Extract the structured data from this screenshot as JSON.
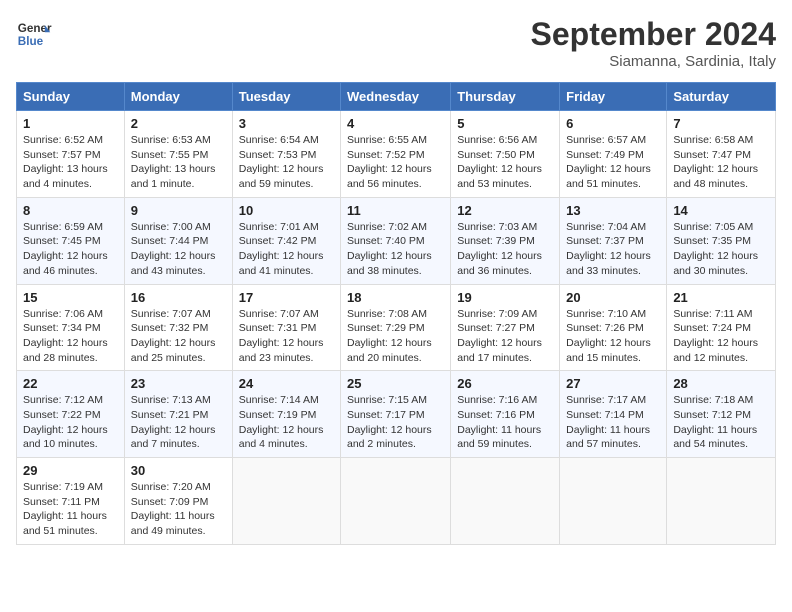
{
  "header": {
    "logo_line1": "General",
    "logo_line2": "Blue",
    "month_title": "September 2024",
    "location": "Siamanna, Sardinia, Italy"
  },
  "days_of_week": [
    "Sunday",
    "Monday",
    "Tuesday",
    "Wednesday",
    "Thursday",
    "Friday",
    "Saturday"
  ],
  "weeks": [
    [
      {
        "num": "1",
        "info": "Sunrise: 6:52 AM\nSunset: 7:57 PM\nDaylight: 13 hours\nand 4 minutes."
      },
      {
        "num": "2",
        "info": "Sunrise: 6:53 AM\nSunset: 7:55 PM\nDaylight: 13 hours\nand 1 minute."
      },
      {
        "num": "3",
        "info": "Sunrise: 6:54 AM\nSunset: 7:53 PM\nDaylight: 12 hours\nand 59 minutes."
      },
      {
        "num": "4",
        "info": "Sunrise: 6:55 AM\nSunset: 7:52 PM\nDaylight: 12 hours\nand 56 minutes."
      },
      {
        "num": "5",
        "info": "Sunrise: 6:56 AM\nSunset: 7:50 PM\nDaylight: 12 hours\nand 53 minutes."
      },
      {
        "num": "6",
        "info": "Sunrise: 6:57 AM\nSunset: 7:49 PM\nDaylight: 12 hours\nand 51 minutes."
      },
      {
        "num": "7",
        "info": "Sunrise: 6:58 AM\nSunset: 7:47 PM\nDaylight: 12 hours\nand 48 minutes."
      }
    ],
    [
      {
        "num": "8",
        "info": "Sunrise: 6:59 AM\nSunset: 7:45 PM\nDaylight: 12 hours\nand 46 minutes."
      },
      {
        "num": "9",
        "info": "Sunrise: 7:00 AM\nSunset: 7:44 PM\nDaylight: 12 hours\nand 43 minutes."
      },
      {
        "num": "10",
        "info": "Sunrise: 7:01 AM\nSunset: 7:42 PM\nDaylight: 12 hours\nand 41 minutes."
      },
      {
        "num": "11",
        "info": "Sunrise: 7:02 AM\nSunset: 7:40 PM\nDaylight: 12 hours\nand 38 minutes."
      },
      {
        "num": "12",
        "info": "Sunrise: 7:03 AM\nSunset: 7:39 PM\nDaylight: 12 hours\nand 36 minutes."
      },
      {
        "num": "13",
        "info": "Sunrise: 7:04 AM\nSunset: 7:37 PM\nDaylight: 12 hours\nand 33 minutes."
      },
      {
        "num": "14",
        "info": "Sunrise: 7:05 AM\nSunset: 7:35 PM\nDaylight: 12 hours\nand 30 minutes."
      }
    ],
    [
      {
        "num": "15",
        "info": "Sunrise: 7:06 AM\nSunset: 7:34 PM\nDaylight: 12 hours\nand 28 minutes."
      },
      {
        "num": "16",
        "info": "Sunrise: 7:07 AM\nSunset: 7:32 PM\nDaylight: 12 hours\nand 25 minutes."
      },
      {
        "num": "17",
        "info": "Sunrise: 7:07 AM\nSunset: 7:31 PM\nDaylight: 12 hours\nand 23 minutes."
      },
      {
        "num": "18",
        "info": "Sunrise: 7:08 AM\nSunset: 7:29 PM\nDaylight: 12 hours\nand 20 minutes."
      },
      {
        "num": "19",
        "info": "Sunrise: 7:09 AM\nSunset: 7:27 PM\nDaylight: 12 hours\nand 17 minutes."
      },
      {
        "num": "20",
        "info": "Sunrise: 7:10 AM\nSunset: 7:26 PM\nDaylight: 12 hours\nand 15 minutes."
      },
      {
        "num": "21",
        "info": "Sunrise: 7:11 AM\nSunset: 7:24 PM\nDaylight: 12 hours\nand 12 minutes."
      }
    ],
    [
      {
        "num": "22",
        "info": "Sunrise: 7:12 AM\nSunset: 7:22 PM\nDaylight: 12 hours\nand 10 minutes."
      },
      {
        "num": "23",
        "info": "Sunrise: 7:13 AM\nSunset: 7:21 PM\nDaylight: 12 hours\nand 7 minutes."
      },
      {
        "num": "24",
        "info": "Sunrise: 7:14 AM\nSunset: 7:19 PM\nDaylight: 12 hours\nand 4 minutes."
      },
      {
        "num": "25",
        "info": "Sunrise: 7:15 AM\nSunset: 7:17 PM\nDaylight: 12 hours\nand 2 minutes."
      },
      {
        "num": "26",
        "info": "Sunrise: 7:16 AM\nSunset: 7:16 PM\nDaylight: 11 hours\nand 59 minutes."
      },
      {
        "num": "27",
        "info": "Sunrise: 7:17 AM\nSunset: 7:14 PM\nDaylight: 11 hours\nand 57 minutes."
      },
      {
        "num": "28",
        "info": "Sunrise: 7:18 AM\nSunset: 7:12 PM\nDaylight: 11 hours\nand 54 minutes."
      }
    ],
    [
      {
        "num": "29",
        "info": "Sunrise: 7:19 AM\nSunset: 7:11 PM\nDaylight: 11 hours\nand 51 minutes."
      },
      {
        "num": "30",
        "info": "Sunrise: 7:20 AM\nSunset: 7:09 PM\nDaylight: 11 hours\nand 49 minutes."
      },
      {
        "num": "",
        "info": ""
      },
      {
        "num": "",
        "info": ""
      },
      {
        "num": "",
        "info": ""
      },
      {
        "num": "",
        "info": ""
      },
      {
        "num": "",
        "info": ""
      }
    ]
  ]
}
